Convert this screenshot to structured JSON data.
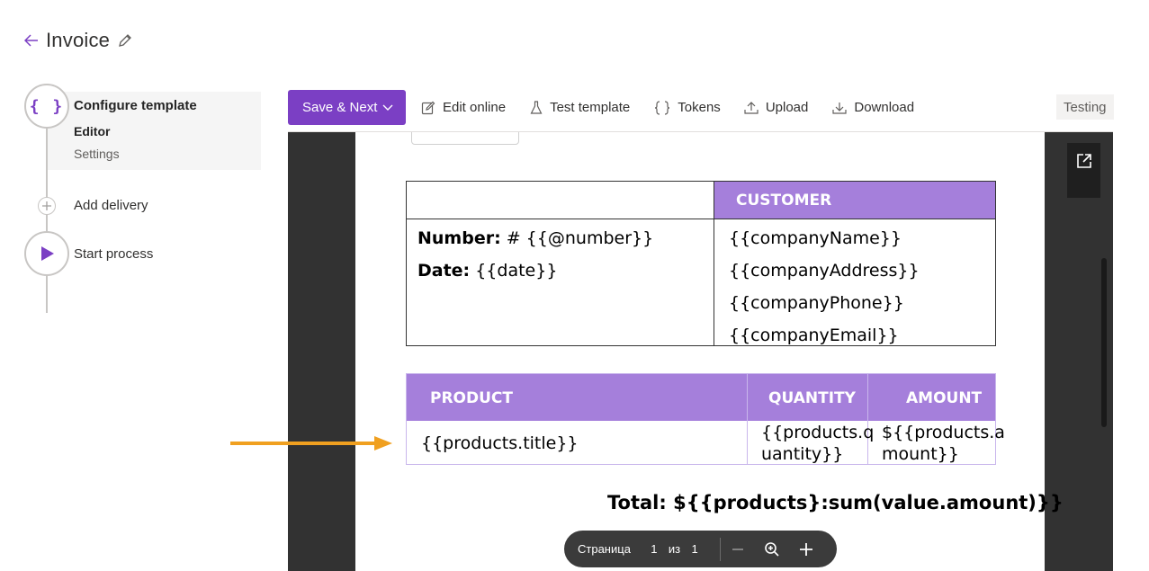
{
  "header": {
    "title": "Invoice"
  },
  "stepper": {
    "configure": {
      "label": "Configure template",
      "subitems": [
        "Editor",
        "Settings"
      ]
    },
    "delivery": {
      "label": "Add delivery"
    },
    "start": {
      "label": "Start process"
    }
  },
  "toolbar": {
    "save_label": "Save & Next",
    "edit_online": "Edit online",
    "test_template": "Test template",
    "tokens": "Tokens",
    "upload": "Upload",
    "download": "Download",
    "status_badge": "Testing"
  },
  "document": {
    "customer_header": "CUSTOMER",
    "number_label": "Number:",
    "number_value": " # {{@number}}",
    "date_label": "Date:",
    "date_value": " {{date}}",
    "customer_fields": [
      "{{companyName}}",
      "{{companyAddress}}",
      "{{companyPhone}}",
      "{{companyEmail}}"
    ],
    "product_headers": {
      "product": "PRODUCT",
      "quantity": "QUANTITY",
      "amount": "AMOUNT"
    },
    "product_row": {
      "title": "{{products.title}}",
      "quantity_line1": "{{products.q",
      "quantity_line2": "uantity}}",
      "amount_line1": "${{products.a",
      "amount_line2": "mount}}"
    },
    "total": "Total: ${{products}:sum(value.amount)}}"
  },
  "pager": {
    "page_label": "Страница",
    "current": "1",
    "of_label": "из",
    "total": "1"
  },
  "colors": {
    "accent": "#7b3fc4",
    "table_header": "#a57fdb",
    "annotation_arrow": "#f0a020"
  }
}
